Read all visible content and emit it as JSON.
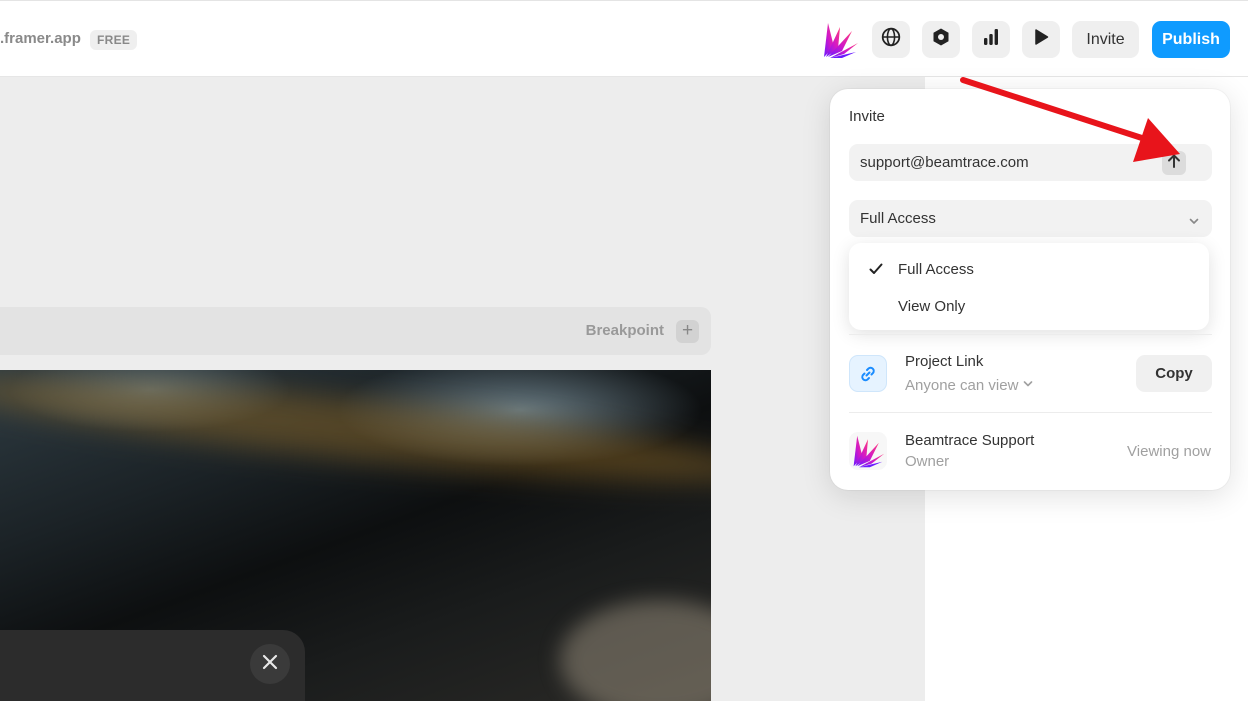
{
  "topbar": {
    "site_url": ".framer.app",
    "plan_badge": "FREE",
    "icons": [
      "framer-logo-icon",
      "globe-icon",
      "hexagon-icon",
      "bar-chart-icon",
      "play-icon"
    ],
    "invite_label": "Invite",
    "publish_label": "Publish",
    "publish_color": "#0f9bff"
  },
  "canvas": {
    "breakpoint_label": "Breakpoint",
    "breakpoint_add": "+"
  },
  "invite_popover": {
    "title": "Invite",
    "email_value": "support@beamtrace.com",
    "access_selected": "Full Access",
    "access_options": [
      {
        "label": "Full Access",
        "checked": true
      },
      {
        "label": "View Only",
        "checked": false
      }
    ],
    "project_link": {
      "title": "Project Link",
      "permission": "Anyone can view",
      "copy_label": "Copy"
    },
    "members": [
      {
        "name": "Beamtrace Support",
        "role": "Owner",
        "status": "Viewing now"
      }
    ]
  },
  "annotation": {
    "arrow_color": "#e8141b",
    "points_to": "send-invite-button"
  }
}
